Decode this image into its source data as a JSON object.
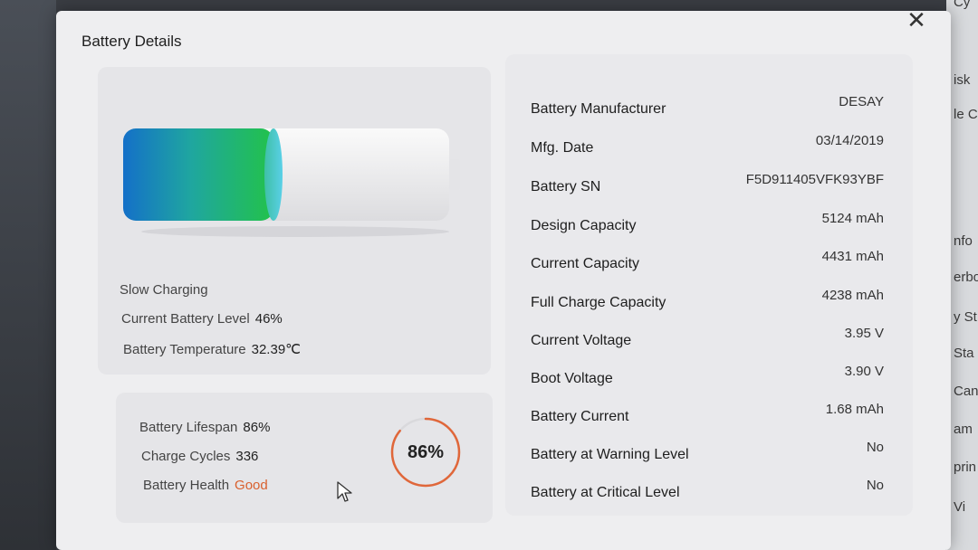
{
  "dialog": {
    "title": "Battery Details"
  },
  "battery": {
    "level_fraction": 0.46,
    "charging_status": "Slow Charging",
    "current_level_label": "Current Battery Level",
    "current_level_value": "46%",
    "temperature_label": "Battery Temperature",
    "temperature_value": "32.39℃"
  },
  "health": {
    "lifespan_label": "Battery Lifespan",
    "lifespan_value": "86%",
    "cycles_label": "Charge Cycles",
    "cycles_value": "336",
    "health_label": "Battery Health",
    "health_value": "Good",
    "ring_value": "86%",
    "ring_fraction": 0.86
  },
  "details": [
    {
      "label": "Battery Manufacturer",
      "value": "DESAY"
    },
    {
      "label": "Mfg. Date",
      "value": "03/14/2019"
    },
    {
      "label": "Battery SN",
      "value": "F5D911405VFK93YBF"
    },
    {
      "label": "Design Capacity",
      "value": "5124 mAh"
    },
    {
      "label": "Current Capacity",
      "value": "4431 mAh"
    },
    {
      "label": "Full Charge Capacity",
      "value": "4238 mAh"
    },
    {
      "label": "Current Voltage",
      "value": "3.95 V"
    },
    {
      "label": "Boot Voltage",
      "value": "3.90 V"
    },
    {
      "label": "Battery Current",
      "value": "1.68 mAh"
    },
    {
      "label": "Battery at Warning Level",
      "value": "No"
    },
    {
      "label": "Battery at Critical Level",
      "value": "No"
    }
  ],
  "background_fragments": [
    "Cy",
    "isk",
    "le C",
    "nfo",
    "erbo",
    "y St",
    "Sta",
    "Can",
    "am",
    "prin",
    "Vi"
  ],
  "colors": {
    "accent_orange": "#e0673a",
    "health_good": "#d9602e",
    "battery_fill_start": "#1470c8",
    "battery_fill_end": "#22c24a"
  }
}
